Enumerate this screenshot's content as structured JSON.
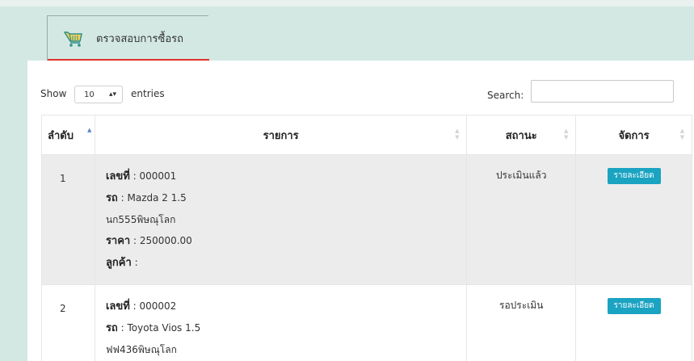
{
  "tab": {
    "icon": "cart-icon",
    "label": "ตรวจสอบการซื้อรถ",
    "accent_color": "#e0322a"
  },
  "controls": {
    "show_label": "Show",
    "page_length": "10",
    "entries_label": "entries",
    "search_label": "Search:",
    "search_value": ""
  },
  "table": {
    "headers": {
      "no": "ลำดับ",
      "list": "รายการ",
      "status": "สถานะ",
      "manage": "จัดการ"
    },
    "rows": [
      {
        "no": "1",
        "number_label": "เลขที่",
        "number_value": " : 000001",
        "car_label": "รถ",
        "car_value": " : Mazda 2 1.5",
        "plate": "นก555พิษณุโลก",
        "price_label": "ราคา",
        "price_value": " : 250000.00",
        "customer_label": "ลูกค้า",
        "customer_value": " :",
        "status": "ประเมินแล้ว",
        "action": "รายละเอียด"
      },
      {
        "no": "2",
        "number_label": "เลขที่",
        "number_value": " : 000002",
        "car_label": "รถ",
        "car_value": " : Toyota Vios 1.5",
        "plate": "ฟฟ436พิษณุโลก",
        "status": "รอประเมิน",
        "action": "รายละเอียด"
      }
    ],
    "button_color": "#1ba3c2"
  }
}
